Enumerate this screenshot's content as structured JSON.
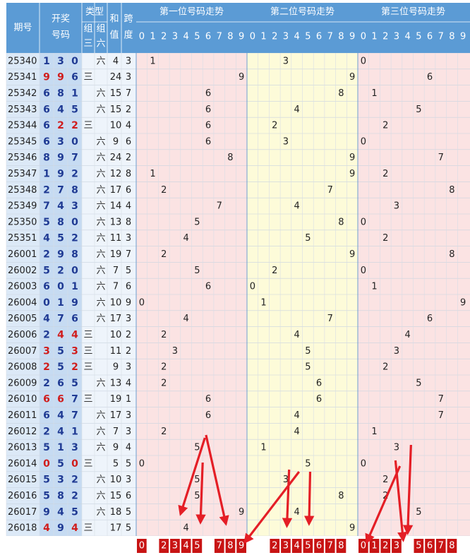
{
  "header": {
    "period": "期号",
    "draw": [
      "开奖",
      "号码"
    ],
    "type_title": "类型",
    "type_sub": [
      "组\n三",
      "组\n六"
    ],
    "sum": [
      "和",
      "值"
    ],
    "span": [
      "跨",
      "度"
    ],
    "pos1": "第一位号码走势",
    "pos2": "第二位号码走势",
    "pos3": "第三位号码走势",
    "digits": [
      "0",
      "1",
      "2",
      "3",
      "4",
      "5",
      "6",
      "7",
      "8",
      "9"
    ]
  },
  "colors": {
    "header_bg": "#5b9bd5",
    "header_text": "#ffffff",
    "period_col_bg": "#dce9f7",
    "draw_col_bg": "#c6dbf2",
    "pos1_bg": "#fbe3e3",
    "pos2_bg": "#fdfbd9",
    "pos3_bg": "#fbe3e3",
    "num_normal": "#1f3a93",
    "num_repeat": "#d01c1c",
    "footer_bg": "#c81414",
    "arrow": "#e41e26"
  },
  "chart_data": {
    "type": "table",
    "rows": [
      {
        "period": "25340",
        "digits": [
          1,
          3,
          0
        ],
        "group": "六",
        "sum": 4,
        "span": 3
      },
      {
        "period": "25341",
        "digits": [
          9,
          9,
          6
        ],
        "group": "三",
        "sum": 24,
        "span": 3
      },
      {
        "period": "25342",
        "digits": [
          6,
          8,
          1
        ],
        "group": "六",
        "sum": 15,
        "span": 7
      },
      {
        "period": "25343",
        "digits": [
          6,
          4,
          5
        ],
        "group": "六",
        "sum": 15,
        "span": 2
      },
      {
        "period": "25344",
        "digits": [
          6,
          2,
          2
        ],
        "group": "三",
        "sum": 10,
        "span": 4
      },
      {
        "period": "25345",
        "digits": [
          6,
          3,
          0
        ],
        "group": "六",
        "sum": 9,
        "span": 6
      },
      {
        "period": "25346",
        "digits": [
          8,
          9,
          7
        ],
        "group": "六",
        "sum": 24,
        "span": 2
      },
      {
        "period": "25347",
        "digits": [
          1,
          9,
          2
        ],
        "group": "六",
        "sum": 12,
        "span": 8
      },
      {
        "period": "25348",
        "digits": [
          2,
          7,
          8
        ],
        "group": "六",
        "sum": 17,
        "span": 6
      },
      {
        "period": "25349",
        "digits": [
          7,
          4,
          3
        ],
        "group": "六",
        "sum": 14,
        "span": 4
      },
      {
        "period": "25350",
        "digits": [
          5,
          8,
          0
        ],
        "group": "六",
        "sum": 13,
        "span": 8
      },
      {
        "period": "25351",
        "digits": [
          4,
          5,
          2
        ],
        "group": "六",
        "sum": 11,
        "span": 3
      },
      {
        "period": "26001",
        "digits": [
          2,
          9,
          8
        ],
        "group": "六",
        "sum": 19,
        "span": 7
      },
      {
        "period": "26002",
        "digits": [
          5,
          2,
          0
        ],
        "group": "六",
        "sum": 7,
        "span": 5
      },
      {
        "period": "26003",
        "digits": [
          6,
          0,
          1
        ],
        "group": "六",
        "sum": 7,
        "span": 6
      },
      {
        "period": "26004",
        "digits": [
          0,
          1,
          9
        ],
        "group": "六",
        "sum": 10,
        "span": 9
      },
      {
        "period": "26005",
        "digits": [
          4,
          7,
          6
        ],
        "group": "六",
        "sum": 17,
        "span": 3
      },
      {
        "period": "26006",
        "digits": [
          2,
          4,
          4
        ],
        "group": "三",
        "sum": 10,
        "span": 2
      },
      {
        "period": "26007",
        "digits": [
          3,
          5,
          3
        ],
        "group": "三",
        "sum": 11,
        "span": 2
      },
      {
        "period": "26008",
        "digits": [
          2,
          5,
          2
        ],
        "group": "三",
        "sum": 9,
        "span": 3
      },
      {
        "period": "26009",
        "digits": [
          2,
          6,
          5
        ],
        "group": "六",
        "sum": 13,
        "span": 4
      },
      {
        "period": "26010",
        "digits": [
          6,
          6,
          7
        ],
        "group": "三",
        "sum": 19,
        "span": 1
      },
      {
        "period": "26011",
        "digits": [
          6,
          4,
          7
        ],
        "group": "六",
        "sum": 17,
        "span": 3
      },
      {
        "period": "26012",
        "digits": [
          2,
          4,
          1
        ],
        "group": "六",
        "sum": 7,
        "span": 3
      },
      {
        "period": "26013",
        "digits": [
          5,
          1,
          3
        ],
        "group": "六",
        "sum": 9,
        "span": 4
      },
      {
        "period": "26014",
        "digits": [
          0,
          5,
          0
        ],
        "group": "三",
        "sum": 5,
        "span": 5
      },
      {
        "period": "26015",
        "digits": [
          5,
          3,
          2
        ],
        "group": "六",
        "sum": 10,
        "span": 3
      },
      {
        "period": "26016",
        "digits": [
          5,
          8,
          2
        ],
        "group": "六",
        "sum": 15,
        "span": 6
      },
      {
        "period": "26017",
        "digits": [
          9,
          4,
          5
        ],
        "group": "六",
        "sum": 18,
        "span": 5
      },
      {
        "period": "26018",
        "digits": [
          4,
          9,
          4
        ],
        "group": "三",
        "sum": 17,
        "span": 5
      }
    ],
    "repeat_highlight": [
      [
        false,
        false,
        false
      ],
      [
        true,
        true,
        false
      ],
      [
        false,
        false,
        false
      ],
      [
        false,
        false,
        false
      ],
      [
        false,
        true,
        true
      ],
      [
        false,
        false,
        false
      ],
      [
        false,
        false,
        false
      ],
      [
        false,
        false,
        false
      ],
      [
        false,
        false,
        false
      ],
      [
        false,
        false,
        false
      ],
      [
        false,
        false,
        false
      ],
      [
        false,
        false,
        false
      ],
      [
        false,
        false,
        false
      ],
      [
        false,
        false,
        false
      ],
      [
        false,
        false,
        false
      ],
      [
        false,
        false,
        false
      ],
      [
        false,
        false,
        false
      ],
      [
        false,
        true,
        true
      ],
      [
        true,
        false,
        true
      ],
      [
        true,
        false,
        true
      ],
      [
        false,
        false,
        false
      ],
      [
        true,
        true,
        false
      ],
      [
        false,
        false,
        false
      ],
      [
        false,
        false,
        false
      ],
      [
        false,
        false,
        false
      ],
      [
        true,
        false,
        true
      ],
      [
        false,
        false,
        false
      ],
      [
        false,
        false,
        false
      ],
      [
        false,
        false,
        false
      ],
      [
        true,
        false,
        true
      ]
    ],
    "picks": [
      [
        "0",
        "",
        "2",
        "3",
        "4",
        "5",
        "",
        "7",
        "8",
        "9"
      ],
      [
        "",
        "",
        "2",
        "3",
        "4",
        "5",
        "6",
        "7",
        "8",
        ""
      ],
      [
        "0",
        "1",
        "2",
        "3",
        "",
        "5",
        "6",
        "7",
        "8",
        ""
      ]
    ]
  }
}
